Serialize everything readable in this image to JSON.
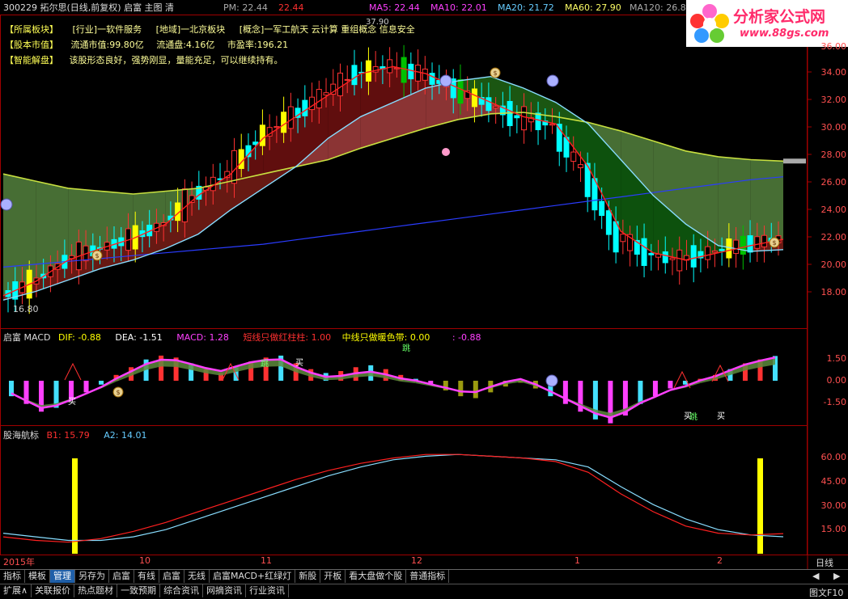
{
  "header": {
    "code_name": "300229 拓尔思(日线,前复权) 启富 主图 清",
    "pm_label": "PM: 22.44",
    "pm2": "22.44",
    "ma5": "MA5: 22.44",
    "ma10": "MA10: 22.01",
    "ma20": "MA20: 21.72",
    "ma60": "MA60: 27.90",
    "ma120": "MA120: 26.8"
  },
  "logo": {
    "title": "分析家公式网",
    "url": "www.88gs.com"
  },
  "info": {
    "row1_tag": "【所属板块】",
    "row1_items": [
      "[行业]一软件服务",
      "[地域]一北京板块",
      "[概念]一军工航天 云计算 重组概念 信息安全"
    ],
    "row2_tag": "【股本市值】",
    "row2_items": [
      "流通市值:99.80亿",
      "流通盘:4.16亿",
      "市盈率:196.21"
    ],
    "row3_tag": "【智能解盘】",
    "row3_text": "该股形态良好，强势刚显，量能充足，可以继续持有。"
  },
  "price_labels": {
    "high": "37.90",
    "low": "16.80"
  },
  "macd_header": {
    "name": "启富 MACD",
    "dif": "DIF: -0.88",
    "dea": "DEA: -1.51",
    "macd": "MACD: 1.28",
    "short": "短线只做红柱柱: 1.00",
    "mid": "中线只做暖色带: 0.00",
    "extra": ": -0.88"
  },
  "nav_header": {
    "name": "股海航标",
    "b1": "B1: 15.79",
    "a2": "A2: 14.01"
  },
  "axes": {
    "price": [
      "36.00",
      "34.00",
      "32.00",
      "30.00",
      "28.00",
      "26.00",
      "24.00",
      "22.00",
      "20.00",
      "18.00"
    ],
    "macd": [
      "1.50",
      "0.00",
      "-1.50"
    ],
    "nav": [
      "60.00",
      "45.00",
      "30.00",
      "15.00"
    ],
    "dates": [
      "2015年",
      "10",
      "11",
      "12",
      "1",
      "2"
    ],
    "period": "日线"
  },
  "toolbar": [
    "指标",
    "模板",
    "管理",
    "另存为",
    "启富",
    "有线",
    "启富",
    "无线",
    "启富MACD+红绿灯",
    "新股",
    "开板",
    "看大盘做个股",
    "普通指标"
  ],
  "toolbar_selected": 2,
  "toolbar2": [
    "扩展∧",
    "关联报价",
    "热点题材",
    "一致预期",
    "综合资讯",
    "网摘资讯",
    "行业资讯"
  ],
  "toolbar2_right": "图文F10",
  "markers": {
    "buy": "买",
    "jump": "跳",
    "coin": "$"
  },
  "colors": {
    "up": "#ff3232",
    "down": "#00ffff",
    "yellow": "#ffff00",
    "green": "#00c000",
    "magenta": "#ff40ff",
    "frame": "#a00000"
  },
  "chart_data": [
    {
      "type": "line",
      "title": "300229 拓尔思(日线,前复权)",
      "ylim": [
        16.8,
        37.9
      ],
      "series": [
        {
          "name": "MA5",
          "values": [
            18.5,
            19.5,
            21.0,
            21.8,
            22.5,
            23.5,
            25.5,
            27.0,
            29.5,
            31.0,
            32.5,
            34.0,
            34.5,
            34.0,
            33.0,
            32.0,
            31.0,
            30.5,
            27.5,
            23.0,
            21.5,
            21.0,
            21.5,
            22.0,
            22.44
          ]
        },
        {
          "name": "MA20",
          "values": [
            18.2,
            18.8,
            19.6,
            20.4,
            21.0,
            21.8,
            22.8,
            24.5,
            26.0,
            27.5,
            29.5,
            31.0,
            32.0,
            33.0,
            33.5,
            33.8,
            33.0,
            32.0,
            30.5,
            28.0,
            25.5,
            23.5,
            22.0,
            21.6,
            21.72
          ]
        },
        {
          "name": "MA60",
          "values": [
            27.0,
            26.5,
            26.0,
            25.8,
            25.6,
            25.8,
            26.0,
            26.5,
            27.0,
            27.5,
            28.0,
            28.8,
            29.5,
            30.2,
            30.8,
            31.2,
            31.3,
            31.0,
            30.6,
            30.0,
            29.3,
            28.6,
            28.2,
            28.0,
            27.9
          ]
        },
        {
          "name": "MA120",
          "values": [
            20.5,
            20.7,
            20.9,
            21.1,
            21.3,
            21.5,
            21.7,
            21.9,
            22.1,
            22.4,
            22.7,
            23.0,
            23.3,
            23.6,
            23.9,
            24.2,
            24.5,
            24.8,
            25.1,
            25.4,
            25.7,
            26.0,
            26.3,
            26.6,
            26.8
          ]
        }
      ]
    },
    {
      "type": "bar",
      "title": "启富 MACD",
      "ylim": [
        -2.3,
        2.3
      ],
      "values": [
        -0.8,
        -1.2,
        -1.6,
        -1.4,
        -1.0,
        -0.6,
        -0.2,
        0.3,
        0.7,
        1.1,
        1.3,
        1.2,
        0.9,
        0.6,
        0.4,
        0.7,
        1.0,
        1.2,
        1.3,
        0.9,
        0.6,
        0.4,
        0.5,
        0.7,
        0.8,
        0.6,
        0.3,
        0.1,
        -0.2,
        -0.5,
        -0.8,
        -0.9,
        -0.6,
        -0.3,
        -0.1,
        -0.4,
        -0.8,
        -1.2,
        -1.6,
        -2.0,
        -2.2,
        -1.8,
        -1.2,
        -0.8,
        -0.4,
        -0.2,
        0.1,
        0.3,
        0.6,
        0.9,
        1.1,
        1.28
      ]
    },
    {
      "type": "line",
      "title": "股海航标",
      "ylim": [
        5,
        70
      ],
      "series": [
        {
          "name": "B1",
          "values": [
            14,
            12,
            11,
            13,
            17,
            22,
            28,
            34,
            40,
            46,
            51,
            55,
            58,
            60,
            60,
            59,
            58,
            56,
            50,
            38,
            28,
            20,
            16,
            15,
            15.79
          ]
        },
        {
          "name": "A2",
          "values": [
            16,
            14,
            12,
            12,
            14,
            18,
            24,
            30,
            36,
            42,
            48,
            53,
            57,
            59,
            60,
            59,
            58,
            57,
            53,
            42,
            32,
            24,
            18,
            15,
            14.01
          ]
        }
      ]
    }
  ]
}
